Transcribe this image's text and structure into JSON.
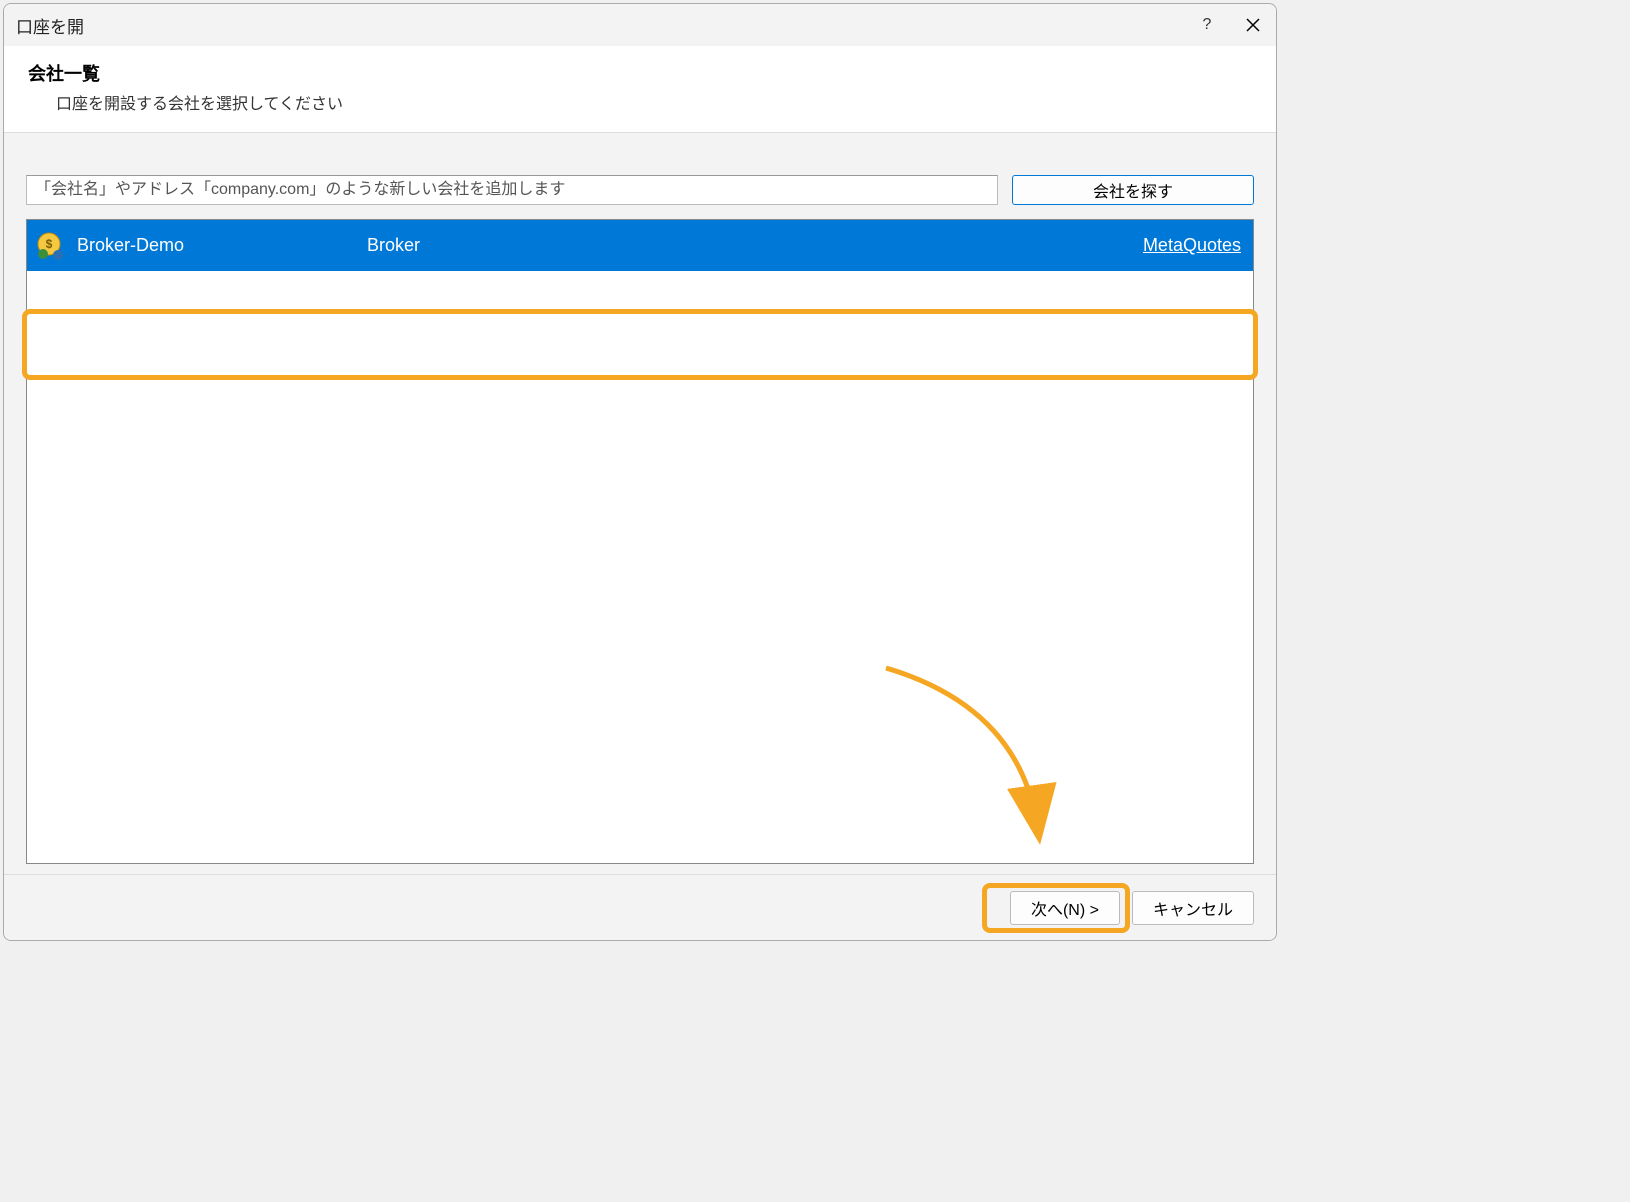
{
  "titlebar": {
    "title": "口座を開"
  },
  "header": {
    "title": "会社一覧",
    "subtitle": "口座を開設する会社を選択してください"
  },
  "search": {
    "placeholder": "「会社名」やアドレス「company.com」のような新しい会社を追加します",
    "button_label": "会社を探す"
  },
  "list": {
    "items": [
      {
        "name": "Broker-Demo",
        "broker_label": "Broker",
        "link": "MetaQuotes"
      }
    ]
  },
  "footer": {
    "next_label": "次へ(N) >",
    "cancel_label": "キャンセル"
  }
}
